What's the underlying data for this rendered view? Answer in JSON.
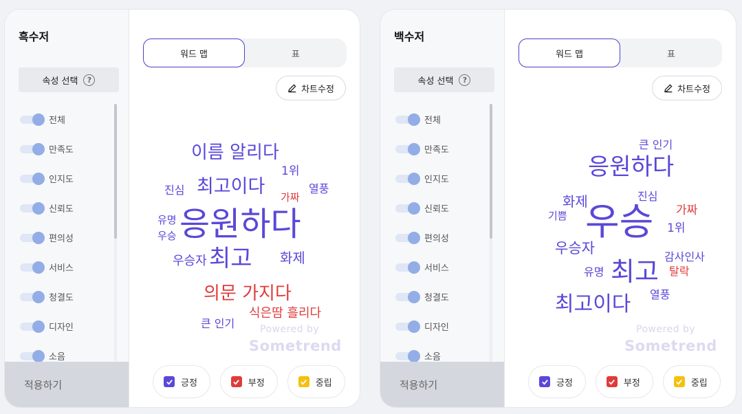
{
  "colors": {
    "positive": "#5a48d8",
    "negative": "#e03b3b",
    "neutral": "#f5c00f",
    "accent": "#4a3fc9"
  },
  "panels": [
    {
      "title": "흑수저",
      "attr_header": "속성 선택",
      "help_icon": "?",
      "attributes": [
        "전체",
        "만족도",
        "인지도",
        "신뢰도",
        "편의성",
        "서비스",
        "청결도",
        "디자인",
        "소음"
      ],
      "apply_label": "적용하기",
      "tabs": [
        "워드 맵",
        "표"
      ],
      "edit_label": "차트수정",
      "watermark": {
        "powered": "Powered by",
        "brand": "Sometrend"
      },
      "legend": [
        "긍정",
        "부정",
        "중립"
      ],
      "words": [
        {
          "text": "이름 알리다",
          "sentiment": "positive"
        },
        {
          "text": "1위",
          "sentiment": "positive"
        },
        {
          "text": "진심",
          "sentiment": "positive"
        },
        {
          "text": "최고이다",
          "sentiment": "positive"
        },
        {
          "text": "열풍",
          "sentiment": "positive"
        },
        {
          "text": "가짜",
          "sentiment": "negative"
        },
        {
          "text": "유명",
          "sentiment": "positive"
        },
        {
          "text": "우승",
          "sentiment": "positive"
        },
        {
          "text": "응원하다",
          "sentiment": "positive"
        },
        {
          "text": "우승자",
          "sentiment": "positive"
        },
        {
          "text": "최고",
          "sentiment": "positive"
        },
        {
          "text": "화제",
          "sentiment": "positive"
        },
        {
          "text": "의문 가지다",
          "sentiment": "negative"
        },
        {
          "text": "식은땀 흘리다",
          "sentiment": "negative"
        },
        {
          "text": "큰 인기",
          "sentiment": "positive"
        }
      ]
    },
    {
      "title": "백수저",
      "attr_header": "속성 선택",
      "help_icon": "?",
      "attributes": [
        "전체",
        "만족도",
        "인지도",
        "신뢰도",
        "편의성",
        "서비스",
        "청결도",
        "디자인",
        "소음"
      ],
      "apply_label": "적용하기",
      "tabs": [
        "워드 맵",
        "표"
      ],
      "edit_label": "차트수정",
      "watermark": {
        "powered": "Powered by",
        "brand": "Sometrend"
      },
      "legend": [
        "긍정",
        "부정",
        "중립"
      ],
      "words": [
        {
          "text": "큰 인기",
          "sentiment": "positive"
        },
        {
          "text": "응원하다",
          "sentiment": "positive"
        },
        {
          "text": "진심",
          "sentiment": "positive"
        },
        {
          "text": "화제",
          "sentiment": "positive"
        },
        {
          "text": "가짜",
          "sentiment": "negative"
        },
        {
          "text": "기쁨",
          "sentiment": "positive"
        },
        {
          "text": "우승",
          "sentiment": "positive"
        },
        {
          "text": "1위",
          "sentiment": "positive"
        },
        {
          "text": "우승자",
          "sentiment": "positive"
        },
        {
          "text": "감사인사",
          "sentiment": "positive"
        },
        {
          "text": "유명",
          "sentiment": "positive"
        },
        {
          "text": "최고",
          "sentiment": "positive"
        },
        {
          "text": "탈락",
          "sentiment": "negative"
        },
        {
          "text": "열풍",
          "sentiment": "positive"
        },
        {
          "text": "최고이다",
          "sentiment": "positive"
        }
      ]
    }
  ]
}
